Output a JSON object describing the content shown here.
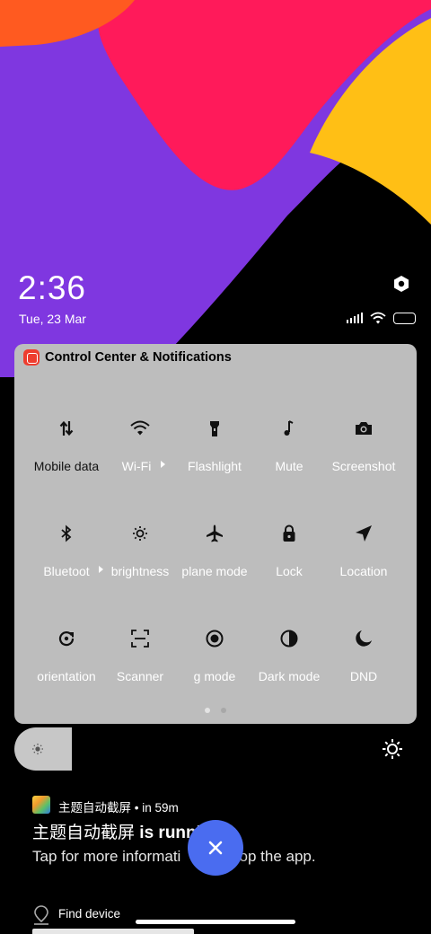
{
  "status": {
    "time": "2:36",
    "date": "Tue, 23 Mar"
  },
  "panel": {
    "title": "Control Center & Notifications",
    "tiles": [
      {
        "label": "Mobile data",
        "icon": "mobile-data-icon",
        "active": true
      },
      {
        "label": "Wi-Fi",
        "icon": "wifi-icon",
        "active": false
      },
      {
        "label": "Flashlight",
        "icon": "flashlight-icon",
        "active": false
      },
      {
        "label": "Mute",
        "icon": "mute-icon",
        "active": false
      },
      {
        "label": "Screenshot",
        "icon": "screenshot-icon",
        "active": false
      },
      {
        "label": "Bluetoot",
        "icon": "bluetooth-icon",
        "active": false
      },
      {
        "label": "brightness",
        "icon": "brightness-icon",
        "active": false
      },
      {
        "label": "plane mode",
        "icon": "airplane-icon",
        "active": false
      },
      {
        "label": "Lock",
        "icon": "lock-icon",
        "active": false
      },
      {
        "label": "Location",
        "icon": "location-icon",
        "active": false
      },
      {
        "label": "orientation",
        "icon": "rotation-icon",
        "active": false
      },
      {
        "label": "Scanner",
        "icon": "scanner-icon",
        "active": false
      },
      {
        "label": "g mode",
        "icon": "reading-mode-icon",
        "active": false
      },
      {
        "label": "Dark mode",
        "icon": "dark-mode-icon",
        "active": false
      },
      {
        "label": "DND",
        "icon": "dnd-icon",
        "active": false
      }
    ],
    "pages": 2,
    "current_page": 1
  },
  "notification": {
    "app": "主题自动截屏",
    "time": "in 59m",
    "title_prefix": "主题自动截屏",
    "title_suffix": " is runni",
    "body": "Tap for more informati        o stop the app."
  },
  "next_notification": {
    "app": "Find device"
  },
  "colors": {
    "fab": "#4a6cf0",
    "panel": "#bdbdbd"
  }
}
